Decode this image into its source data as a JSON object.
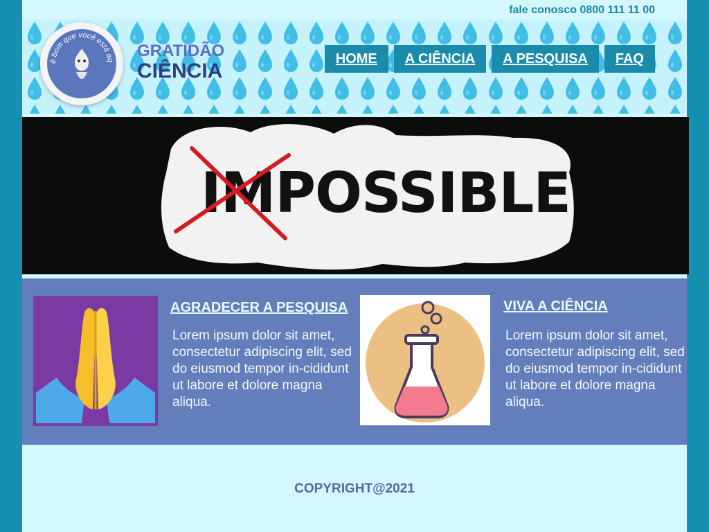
{
  "contact": {
    "text": "fale conosco 0800 111 11 00"
  },
  "brand": {
    "line1": "GRATIDÃO",
    "line2": "CIÊNCIA",
    "badge_text": "é bom que você está aqui!"
  },
  "nav": {
    "items": [
      {
        "label": "HOME"
      },
      {
        "label": "A CIÊNCIA"
      },
      {
        "label": "A PESQUISA"
      },
      {
        "label": "FAQ"
      }
    ]
  },
  "banner": {
    "prefix": "IM",
    "word": "POSSIBLE"
  },
  "features": [
    {
      "title": "AGRADECER A PESQUISA",
      "text": "Lorem ipsum dolor sit amet, consectetur adipiscing elit, sed do eiusmod tempor in-cididunt ut labore et dolore magna aliqua.",
      "icon": "praying-hands-icon"
    },
    {
      "title": "VIVA A CIÊNCIA",
      "text": "Lorem ipsum dolor sit amet, consectetur adipiscing elit, sed do eiusmod tempor in-cididunt ut labore et dolore magna aliqua.",
      "icon": "flask-icon"
    }
  ],
  "footer": {
    "copyright": "COPYRIGHT@2021"
  },
  "colors": {
    "accent": "#1a8bab",
    "panel": "#647ebb",
    "background": "#d4f7fd",
    "frame": "#1590b0"
  }
}
